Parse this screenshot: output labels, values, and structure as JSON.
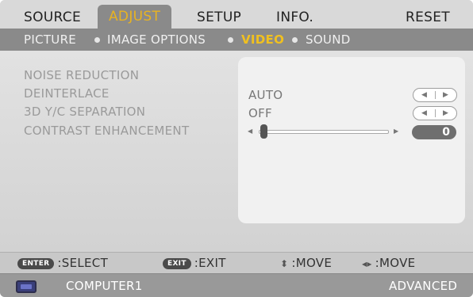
{
  "top_menu": {
    "tabs": [
      {
        "label": "SOURCE"
      },
      {
        "label": "ADJUST"
      },
      {
        "label": "SETUP"
      },
      {
        "label": "INFO."
      }
    ],
    "reset_label": "RESET",
    "active_tab": "ADJUST"
  },
  "sub_menu": {
    "tabs": [
      {
        "label": "PICTURE"
      },
      {
        "label": "IMAGE OPTIONS"
      },
      {
        "label": "VIDEO"
      },
      {
        "label": "SOUND"
      }
    ],
    "active_tab": "VIDEO"
  },
  "settings": {
    "noise_reduction": {
      "label": "NOISE REDUCTION"
    },
    "deinterlace": {
      "label": "DEINTERLACE",
      "value": "AUTO"
    },
    "yc_separation": {
      "label": "3D Y/C SEPARATION",
      "value": "OFF"
    },
    "contrast": {
      "label": "CONTRAST ENHANCEMENT",
      "value": "0"
    }
  },
  "help": {
    "select": {
      "key": "ENTER",
      "text": ":SELECT"
    },
    "exit": {
      "key": "EXIT",
      "text": ":EXIT"
    },
    "move_v": {
      "text": ":MOVE"
    },
    "move_h": {
      "text": ":MOVE"
    }
  },
  "status": {
    "source": "COMPUTER1",
    "mode": "ADVANCED"
  },
  "colors": {
    "active_tab_text": "#e8b321",
    "active_subtab_text": "#f0c020",
    "menu_bg": "#8a8a8a"
  },
  "icons": {
    "source_icon": "monitor-icon"
  }
}
